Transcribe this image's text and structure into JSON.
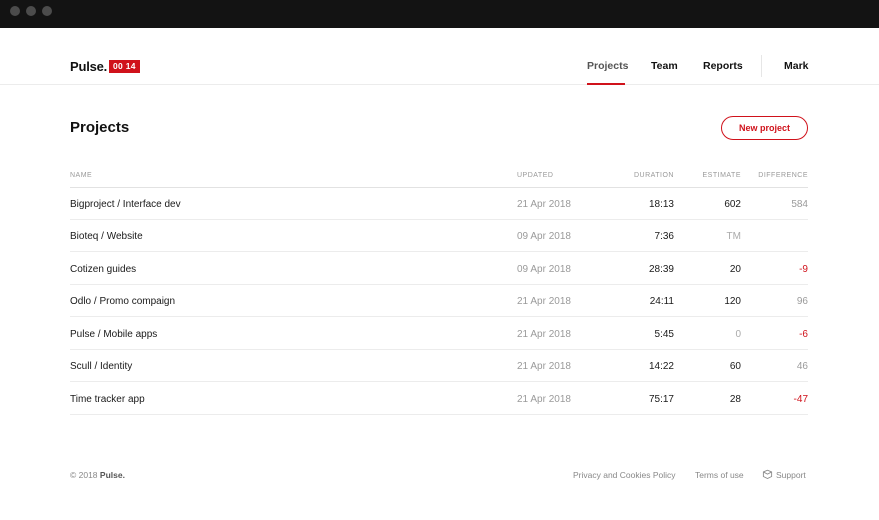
{
  "header": {
    "logo": "Pulse.",
    "timer": "00 14",
    "nav": [
      "Projects",
      "Team",
      "Reports"
    ],
    "user": "Mark"
  },
  "main": {
    "title": "Projects",
    "new_button": "New project",
    "columns": [
      "NAME",
      "UPDATED",
      "DURATION",
      "ESTIMATE",
      "DIFFERENCE"
    ],
    "rows": [
      {
        "name": "Bigproject / Interface dev",
        "updated": "21 Apr 2018",
        "duration": "18:13",
        "estimate": "602",
        "difference": "584"
      },
      {
        "name": "Bioteq / Website",
        "updated": "09 Apr 2018",
        "duration": "7:36",
        "estimate": "TM",
        "difference": ""
      },
      {
        "name": "Cotizen guides",
        "updated": "09 Apr 2018",
        "duration": "28:39",
        "estimate": "20",
        "difference": "-9"
      },
      {
        "name": "Odlo / Promo compaign",
        "updated": "21 Apr 2018",
        "duration": "24:11",
        "estimate": "120",
        "difference": "96"
      },
      {
        "name": "Pulse / Mobile apps",
        "updated": "21 Apr 2018",
        "duration": "5:45",
        "estimate": "0",
        "difference": "-6"
      },
      {
        "name": "Scull / Identity",
        "updated": "21 Apr 2018",
        "duration": "14:22",
        "estimate": "60",
        "difference": "46"
      },
      {
        "name": "Time tracker app",
        "updated": "21 Apr 2018",
        "duration": "75:17",
        "estimate": "28",
        "difference": "-47"
      }
    ]
  },
  "footer": {
    "copyright": "© 2018",
    "brand": "Pulse.",
    "privacy": "Privacy and Cookies Policy",
    "terms": "Terms of use",
    "support": "Support",
    "support_icon": "chat-bubble-icon"
  },
  "colors": {
    "accent": "#d0121b",
    "titlebar": "#131313",
    "muted_text": "#9a9a9a"
  }
}
